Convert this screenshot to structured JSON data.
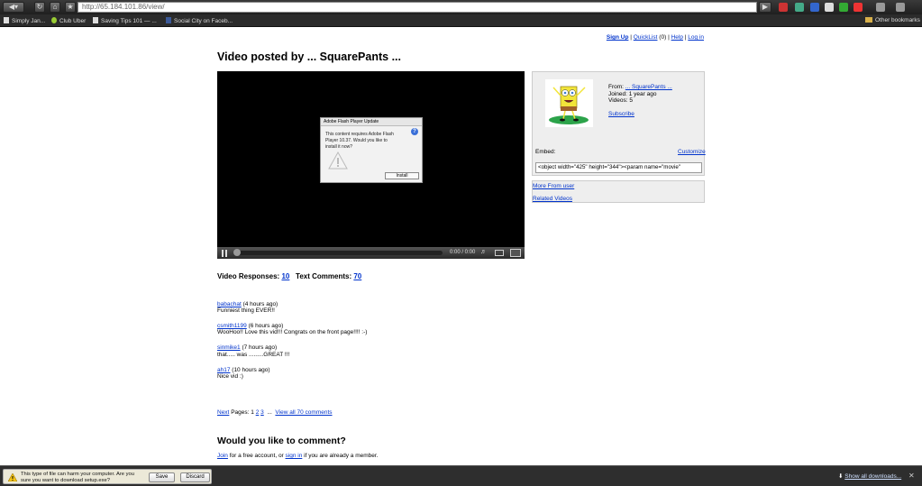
{
  "browser": {
    "url": "http://65.184.101.86/view/",
    "bookmarks": [
      "Simply Jan...",
      "Club Uber",
      "Saving Tips 101 — ...",
      "Social City on Faceb..."
    ],
    "other_bookmarks": "Other bookmarks"
  },
  "topnav": {
    "signup": "Sign Up",
    "sep1": "|",
    "quicklist": "QuickList",
    "quicklist_count": "(0)",
    "sep2": "|",
    "help": "Help",
    "sep3": "|",
    "login": "Log in"
  },
  "page_title": "Video posted by ... SquarePants ...",
  "player": {
    "dialog_title": "Adobe Flash Player Update",
    "dialog_body": "This content requires Adobe Flash Player 10.37. Would you like to install it now?",
    "install_label": "Install",
    "time": "0:00 / 0:00"
  },
  "uploader": {
    "from_label": "From:",
    "from_name": "... SquarePants ...",
    "joined": "Joined: 1 year ago",
    "videos": "Videos: 5",
    "subscribe": "Subscribe",
    "embed_label": "Embed:",
    "customize": "Customize",
    "embed_code": "<object width=\"425\" height=\"344\"><param name=\"movie\""
  },
  "more_from_user": "More From user",
  "related_videos": "Related Videos",
  "responses": {
    "video_label": "Video Responses:",
    "video_count": "10",
    "text_label": "Text Comments:",
    "text_count": "70"
  },
  "comments": [
    {
      "user": "babachat",
      "time": "(4 hours ago)",
      "text": "Funniest thing EVER!!"
    },
    {
      "user": "csmith1199",
      "time": "(6 hours ago)",
      "text": "WooHoo!! Love this vid!!! Congrats on the front page!!!! :-)"
    },
    {
      "user": "sinmike1",
      "time": "(7 hours ago)",
      "text": "that..... was .........GREAT !!!"
    },
    {
      "user": "ah17",
      "time": "(10 hours ago)",
      "text": "Nice vid :)"
    }
  ],
  "pager": {
    "next": "Next",
    "pages_label": "Pages:",
    "current": "1",
    "p2": "2",
    "p3": "3",
    "ellipsis": "...",
    "view_all": "View all 70 comments"
  },
  "comment_heading": "Would you like to comment?",
  "join": {
    "join": "Join",
    "t1": " for a free account, or ",
    "sign_in": "sign in",
    "t2": " if you are already a member."
  },
  "download": {
    "warning": "This type of file can harm your computer. Are you sure you want to download setup.exe?",
    "save": "Save",
    "discard": "Discard",
    "show_all": "Show all downloads..."
  }
}
